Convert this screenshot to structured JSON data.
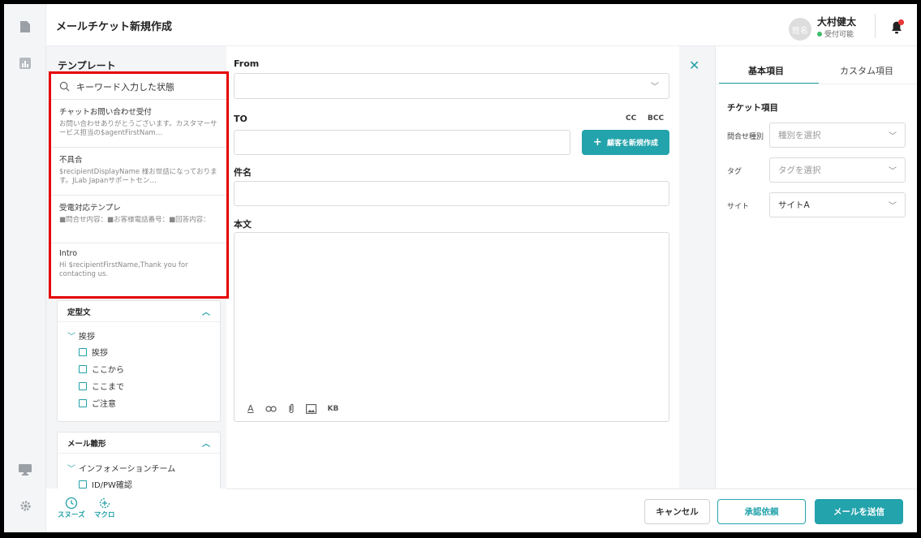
{
  "header": {
    "title": "メールチケット新規作成",
    "avatar_text": "姓名",
    "user_name": "大村健太",
    "user_status": "受付可能"
  },
  "templates": {
    "heading": "テンプレート",
    "search_value": "キーワード入力した状態",
    "items": [
      {
        "title": "チャットお問い合わせ受付",
        "body": "お問い合わせありがとうございます。カスタマーサービス担当の$agentFirstNam…"
      },
      {
        "title": "不具合",
        "body": "$recipientDisplayName 様お世話になっております。JLab Japanサポートセン…"
      },
      {
        "title": "受電対応テンプレ",
        "body": "■問合せ内容：■お客様電話番号：■回答内容："
      },
      {
        "title": "Intro",
        "body": "Hi $recipientFirstName,Thank you for contacting us."
      }
    ]
  },
  "fixed_phrases": {
    "heading": "定型文",
    "group": "挨拶",
    "leaves": [
      "挨拶",
      "ここから",
      "ここまで",
      "ご注意"
    ]
  },
  "mail_forms": {
    "heading": "メール雛形",
    "group": "インフォメーションチーム",
    "leaves": [
      "ID/PW確認"
    ]
  },
  "tools": {
    "snooze": "スヌーズ",
    "macro": "マクロ"
  },
  "compose": {
    "from_label": "From",
    "to_label": "TO",
    "cc_label": "CC",
    "bcc_label": "BCC",
    "new_customer_button": "顧客を新規作成",
    "subject_label": "件名",
    "body_label": "本文",
    "kb_label": "KB"
  },
  "right_panel": {
    "tab_basic": "基本項目",
    "tab_custom": "カスタム項目",
    "section_title": "チケット項目",
    "fields": [
      {
        "label": "問合せ種別",
        "value": "種別を選択"
      },
      {
        "label": "タグ",
        "value": "タグを選択"
      },
      {
        "label": "サイト",
        "value": "サイトA"
      }
    ]
  },
  "footer": {
    "cancel": "キャンセル",
    "approval": "承認依頼",
    "send": "メールを送信"
  },
  "colors": {
    "accent": "#23a3ab",
    "highlight": "#e60000",
    "status_green": "#3cbd6a",
    "bell_badge": "#e53935"
  }
}
